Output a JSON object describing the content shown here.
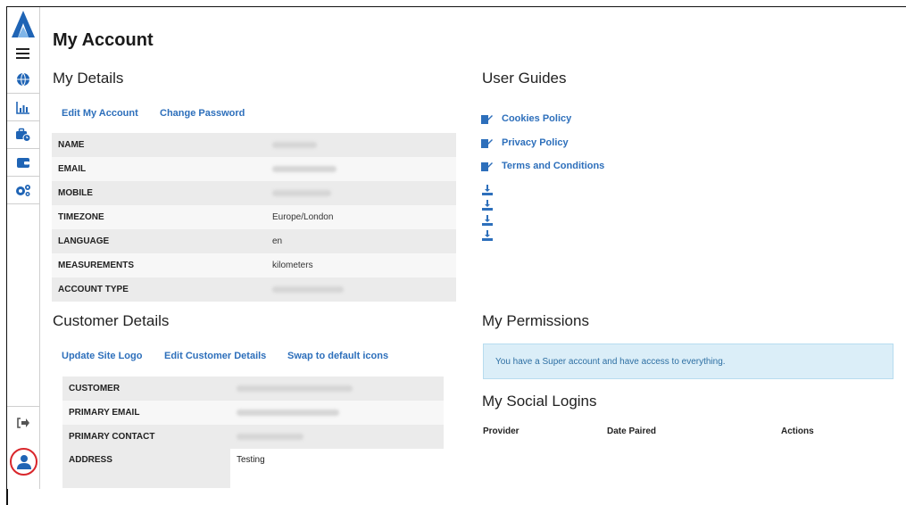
{
  "page_title": "My Account",
  "sidebar": {
    "items": [
      {
        "name": "globe-icon"
      },
      {
        "name": "bar-chart-icon"
      },
      {
        "name": "briefcase-clock-icon"
      },
      {
        "name": "wallet-icon"
      },
      {
        "name": "gears-icon"
      }
    ],
    "logout_icon": "sign-out-icon",
    "user_icon": "user-icon"
  },
  "my_details": {
    "heading": "My Details",
    "links": {
      "edit": "Edit My Account",
      "password": "Change Password"
    },
    "rows": [
      {
        "label": "NAME",
        "value": ""
      },
      {
        "label": "EMAIL",
        "value": ""
      },
      {
        "label": "MOBILE",
        "value": ""
      },
      {
        "label": "TIMEZONE",
        "value": "Europe/London"
      },
      {
        "label": "LANGUAGE",
        "value": "en"
      },
      {
        "label": "MEASUREMENTS",
        "value": "kilometers"
      },
      {
        "label": "ACCOUNT TYPE",
        "value": ""
      }
    ]
  },
  "user_guides": {
    "heading": "User Guides",
    "links": [
      "Cookies Policy",
      "Privacy Policy",
      "Terms and Conditions"
    ]
  },
  "customer_details": {
    "heading": "Customer Details",
    "links": {
      "logo": "Update Site Logo",
      "edit": "Edit Customer Details",
      "icons": "Swap to default icons"
    },
    "rows": [
      {
        "label": "CUSTOMER",
        "value": ""
      },
      {
        "label": "PRIMARY EMAIL",
        "value": ""
      },
      {
        "label": "PRIMARY CONTACT",
        "value": ""
      },
      {
        "label": "ADDRESS",
        "value": "Testing"
      }
    ]
  },
  "permissions": {
    "heading": "My Permissions",
    "message": "You have a Super account and have access to everything."
  },
  "social_logins": {
    "heading": "My Social Logins",
    "columns": [
      "Provider",
      "Date Paired",
      "Actions"
    ]
  },
  "colors": {
    "accent": "#2d6fbb",
    "brand": "#1f64b5",
    "highlight": "#d9262b"
  }
}
